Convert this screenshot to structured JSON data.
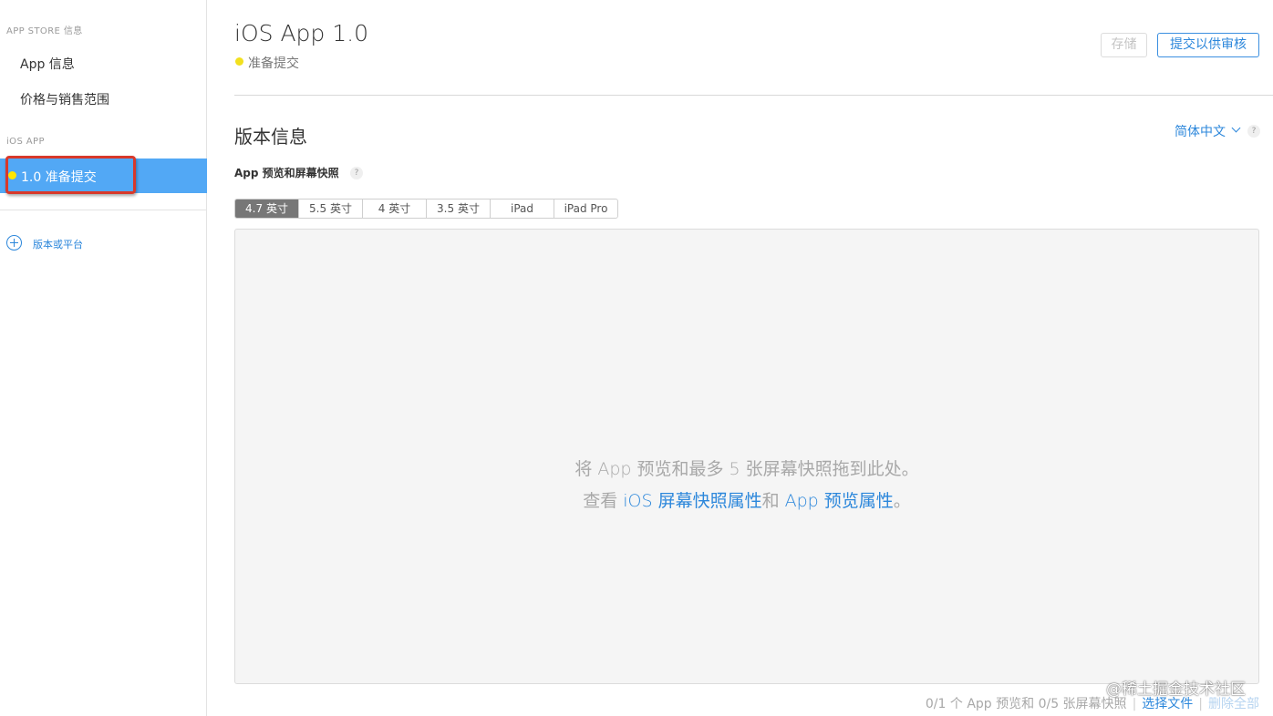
{
  "sidebar": {
    "section1_label": "APP STORE 信息",
    "items": [
      {
        "label": "App 信息"
      },
      {
        "label": "价格与销售范围"
      }
    ],
    "section2_label": "iOS APP",
    "active_item": {
      "label": "1.0 准备提交"
    },
    "add_label": "版本或平台"
  },
  "header": {
    "title": "iOS App 1.0",
    "status": "准备提交",
    "save_label": "存储",
    "submit_label": "提交以供审核"
  },
  "version_info": {
    "title": "版本信息",
    "language": "简体中文",
    "help": "?",
    "subtitle": "App 预览和屏幕快照",
    "device_tabs": [
      "4.7 英寸",
      "5.5 英寸",
      "4 英寸",
      "3.5 英寸",
      "iPad",
      "iPad Pro"
    ],
    "selected_tab": "4.7 英寸"
  },
  "dropzone": {
    "line1": "将 App 预览和最多 5 张屏幕快照拖到此处。",
    "line2_prefix": "查看 ",
    "link1": "iOS 屏幕快照属性",
    "line2_mid": "和 ",
    "link2": "App 预览属性",
    "line2_suffix": "。"
  },
  "footer": {
    "count_text": "0/1 个 App 预览和 0/5 张屏幕快照",
    "separator": "|",
    "choose_file": "选择文件",
    "delete_all": "删除全部"
  },
  "watermark": "@稀土掘金技术社区",
  "colors": {
    "accent": "#2c87db",
    "active_bg": "#52a8f5",
    "status_yellow": "#f2e01e",
    "highlight_red": "#d8382a"
  }
}
